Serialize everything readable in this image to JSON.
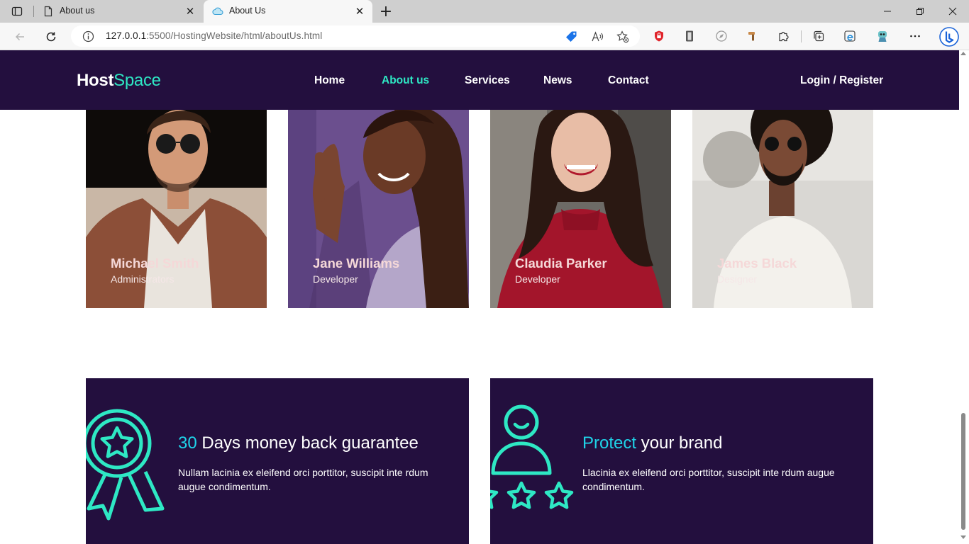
{
  "browser": {
    "tabs": [
      {
        "title": "About us"
      },
      {
        "title": "About Us"
      }
    ],
    "url": {
      "host": "127.0.0.1",
      "path": ":5500/HostingWebsite/html/aboutUs.html"
    }
  },
  "site": {
    "logo": {
      "part1": "Host",
      "part2": "Space"
    },
    "nav": {
      "home": "Home",
      "about": "About us",
      "services": "Services",
      "news": "News",
      "contact": "Contact",
      "login": "Login / Register"
    },
    "team": [
      {
        "name": "Michael Smith",
        "role": "Administrators"
      },
      {
        "name": "Jane Williams",
        "role": "Developer"
      },
      {
        "name": "Claudia Parker",
        "role": "Developer"
      },
      {
        "name": "James Black",
        "role": "Designer"
      }
    ],
    "features": [
      {
        "title_highlight": "30",
        "title_rest": " Days money back guarantee",
        "description": "Nullam lacinia ex eleifend orci porttitor, suscipit inte rdum augue condimentum."
      },
      {
        "title_highlight": "Protect",
        "title_rest": " your brand",
        "description": "Llacinia ex eleifend orci porttitor, suscipit inte rdum augue condimentum."
      }
    ]
  },
  "colors": {
    "header_bg": "#230f3e",
    "accent": "#2ee8c4",
    "title_highlight": "#1fd3e8"
  }
}
